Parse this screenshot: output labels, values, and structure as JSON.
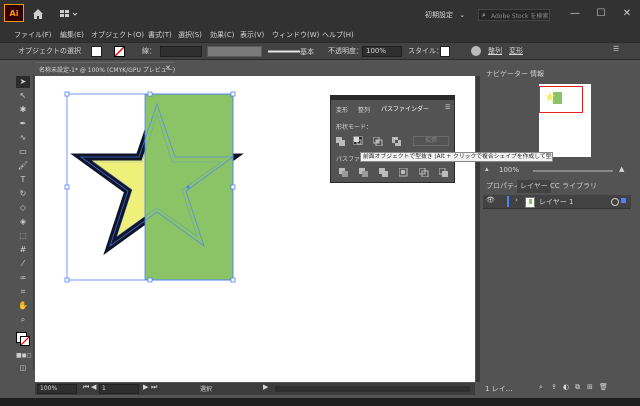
{
  "app": {
    "logo": "Ai",
    "workspace": "初期設定",
    "search_placeholder": "Adobe Stock を検索"
  },
  "menu": [
    "ファイル(F)",
    "編集(E)",
    "オブジェクト(O)",
    "書式(T)",
    "選択(S)",
    "効果(C)",
    "表示(V)",
    "ウィンドウ(W)",
    "ヘルプ(H)"
  ],
  "control": {
    "no_selection": "オブジェクトの選択",
    "stroke_label": "線：",
    "brush_label": "基本",
    "opacity_label": "不透明度：",
    "opacity_value": "100%",
    "style_label": "スタイル：",
    "align_label": "整列",
    "transform_label": "変形"
  },
  "document": {
    "tab_title": "名称未設定-1* @ 100% (CMYK/GPU プレビュー)"
  },
  "status": {
    "zoom": "100%",
    "page": "1",
    "tool": "選択"
  },
  "navigator": {
    "tabs": [
      "ナビゲーター",
      "情報"
    ],
    "zoom": "100%"
  },
  "layers": {
    "tabs": [
      "プロパティ",
      "レイヤー",
      "CC ライブラリ"
    ],
    "items": [
      {
        "name": "レイヤー 1"
      }
    ],
    "footer": "1 レイ…"
  },
  "pathfinder": {
    "tabs": [
      "変形",
      "整列",
      "パスファインダー"
    ],
    "shape_modes_label": "形状モード：",
    "expand_label": "拡張",
    "pathfinders_label": "パスファ",
    "tooltip": "前面オブジェクトで型抜き (Alt + クリックで複合シェイプを作成して型抜き)"
  },
  "colors": {
    "green": "#8bc466",
    "star_fill": "#eff07a",
    "selection": "#4d7fff",
    "accent": "#ff9a00"
  }
}
